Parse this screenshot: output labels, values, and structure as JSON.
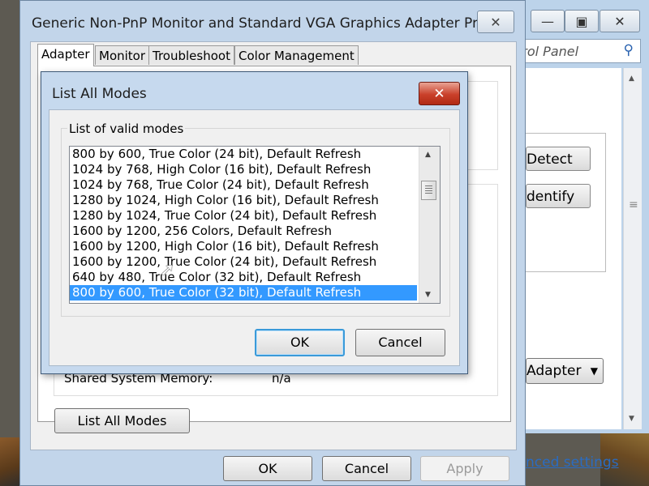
{
  "properties": {
    "title": "Generic Non-PnP Monitor and Standard VGA Graphics Adapter Pro...",
    "tabs": [
      "Adapter",
      "Monitor",
      "Troubleshoot",
      "Color Management"
    ],
    "shared_memory_label": "Shared System Memory:",
    "shared_memory_value": "n/a",
    "list_all_modes_button": "List All Modes",
    "ok_button": "OK",
    "cancel_button": "Cancel",
    "apply_button": "Apply"
  },
  "control_panel": {
    "search_placeholder": "trol Panel",
    "detect_button": "Detect",
    "identify_button": "dentify",
    "adapter_dropdown": "Adapter",
    "advanced_link": "nced settings"
  },
  "dialog": {
    "title": "List All Modes",
    "group_label": "List of valid modes",
    "modes": [
      "800 by 600, True Color (24 bit), Default Refresh",
      "1024 by 768, High Color (16 bit), Default Refresh",
      "1024 by 768, True Color (24 bit), Default Refresh",
      "1280 by 1024, High Color (16 bit), Default Refresh",
      "1280 by 1024, True Color (24 bit), Default Refresh",
      "1600 by 1200, 256 Colors, Default Refresh",
      "1600 by 1200, High Color (16 bit), Default Refresh",
      "1600 by 1200, True Color (24 bit), Default Refresh",
      "640 by 480, True Color (32 bit), Default Refresh",
      "800 by 600, True Color (32 bit), Default Refresh"
    ],
    "selected_mode": "800 by 600, True Color (32 bit), Default Refresh",
    "ok_button": "OK",
    "cancel_button": "Cancel"
  },
  "colors": {
    "selection": "#3399ff",
    "window_frame": "#c2d5ea",
    "close_red": "#c9402a",
    "link": "#2a6cc2"
  }
}
